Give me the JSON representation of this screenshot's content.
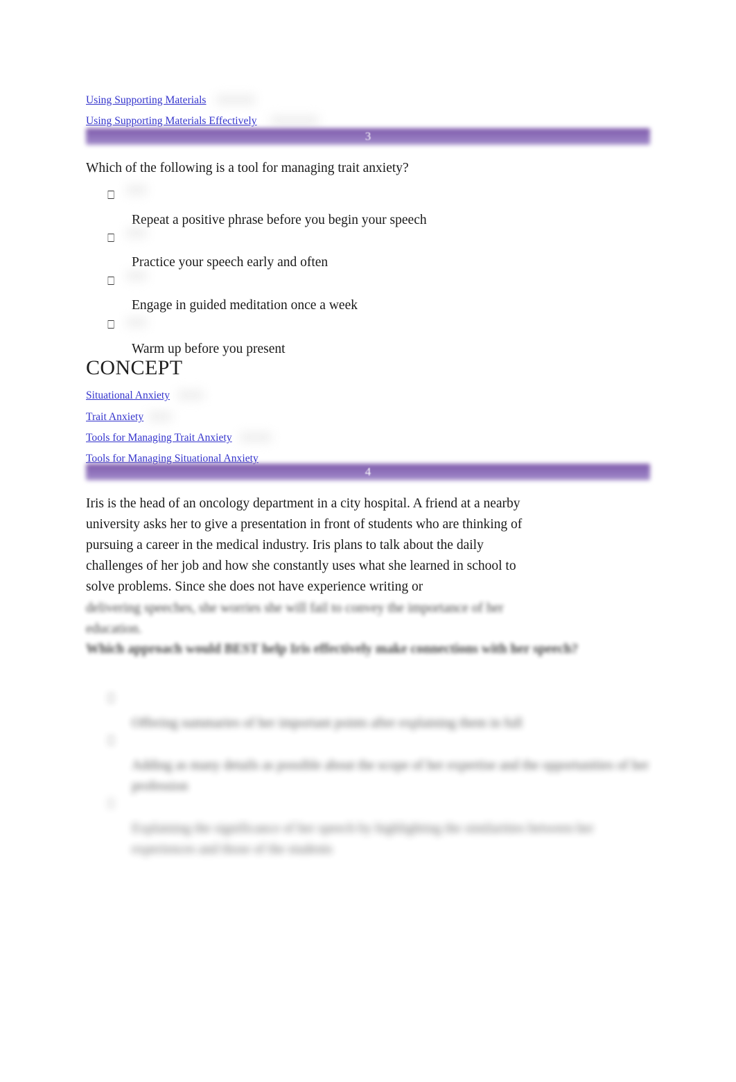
{
  "theme": {
    "link_color": "#3333CC",
    "banner_color": "#9175BD",
    "text_color": "#1A1A1A",
    "background": "#FFFFFF"
  },
  "top_concept_links": [
    {
      "label": "Using Supporting Materials"
    },
    {
      "label": "Using Supporting Materials Effectively"
    }
  ],
  "questions": [
    {
      "number": "3",
      "stem": "Which of the following is a tool for managing trait anxiety?",
      "bullet_glyph": "⎕",
      "options": [
        {
          "text": "Repeat a positive phrase before you begin your speech"
        },
        {
          "text": "Practice your speech early and often"
        },
        {
          "text": "Engage in guided meditation once a week"
        },
        {
          "text": "Warm up before you present"
        }
      ],
      "concept_heading": "CONCEPT",
      "concept_links": [
        {
          "label": "Situational Anxiety"
        },
        {
          "label": "Trait Anxiety"
        },
        {
          "label": "Tools for Managing Trait Anxiety"
        },
        {
          "label": "Tools for Managing Situational Anxiety"
        }
      ]
    },
    {
      "number": "4",
      "stem_clear": "Iris is the head of an oncology department in a city hospital. A friend at a nearby university asks her to give a presentation in front of students who are thinking of pursuing a career in the medical industry. Iris plans to talk about the daily challenges of her job and how she constantly uses what she learned in school to solve problems. Since she does not have experience writing or",
      "stem_blurred_line_1": "delivering speeches, she worries she will fail to convey the importance of her",
      "stem_blurred_line_2": "education.",
      "stem_blurred_bold": "Which approach would BEST help Iris effectively make connections with her speech?",
      "bullet_glyph": "⎕",
      "options": [
        {
          "text": "Offering summaries of her important points after explaining them in full"
        },
        {
          "text": "Adding as many details as possible about the scope of her expertise and the opportunities of her profession"
        },
        {
          "text": "Explaining the significance of her speech by highlighting the similarities between her experiences and those of the students"
        }
      ]
    }
  ]
}
